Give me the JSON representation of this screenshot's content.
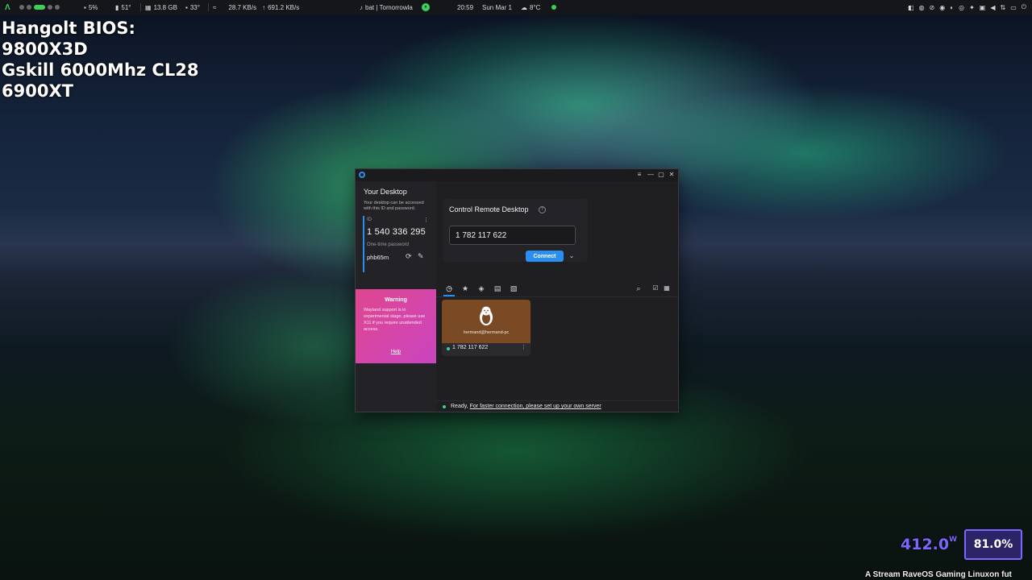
{
  "topbar": {
    "cpu_usage": "5%",
    "cpu_temp": "51°",
    "ram": "13.8 GB",
    "gpu_temp": "33°",
    "net_down": "28.7 KB/s",
    "net_up": "691.2 KB/s",
    "media": "bat | Tomorrowl⁠a",
    "time": "20:59",
    "date": "Sun Mar 1",
    "weather": "8°C"
  },
  "overlay": {
    "line1": "Hangolt BIOS:",
    "line2": "9800X3D",
    "line3": "Gskill 6000Mhz CL28",
    "line4": "6900XT"
  },
  "window": {
    "controls": {
      "menu": "≡",
      "minimize": "—",
      "maximize": "▢",
      "close": "✕"
    }
  },
  "sidebar": {
    "title": "Your Desktop",
    "description": "Your desktop can be accessed with this ID and password.",
    "id_label": "ID",
    "id_value": "1 540 336 295",
    "password_label": "One-time password",
    "password_value": "phb65m"
  },
  "warning": {
    "title": "Warning",
    "body": "Wayland support is in experimental stage, please use X11 if you require unattended access.",
    "help": "Help"
  },
  "control": {
    "title": "Control Remote Desktop",
    "input_value": "1 782 117 622",
    "connect_label": "Connect"
  },
  "tabs": [
    {
      "name": "recent",
      "icon": "clock-icon"
    },
    {
      "name": "favorites",
      "icon": "star-icon"
    },
    {
      "name": "discovered",
      "icon": "compass-icon"
    },
    {
      "name": "address-book",
      "icon": "address-book-icon"
    },
    {
      "name": "group",
      "icon": "group-icon"
    }
  ],
  "peer": {
    "hostname": "hermand@hermand-pc",
    "id": "1 782 117 622"
  },
  "status": {
    "ready": "Ready,",
    "link": "For faster connection, please set up your own server"
  },
  "hud": {
    "watts": "412.0",
    "watt_unit": "W",
    "percent": "81.0%",
    "ticker": "A Stream RaveOS Gaming Linuxon fut"
  },
  "colors": {
    "accent": "#2b8ff0",
    "warning_start": "#e0468e",
    "warning_end": "#c945c0",
    "peer_thumb": "#7a4a25",
    "hud_purple": "#7c66ff"
  }
}
